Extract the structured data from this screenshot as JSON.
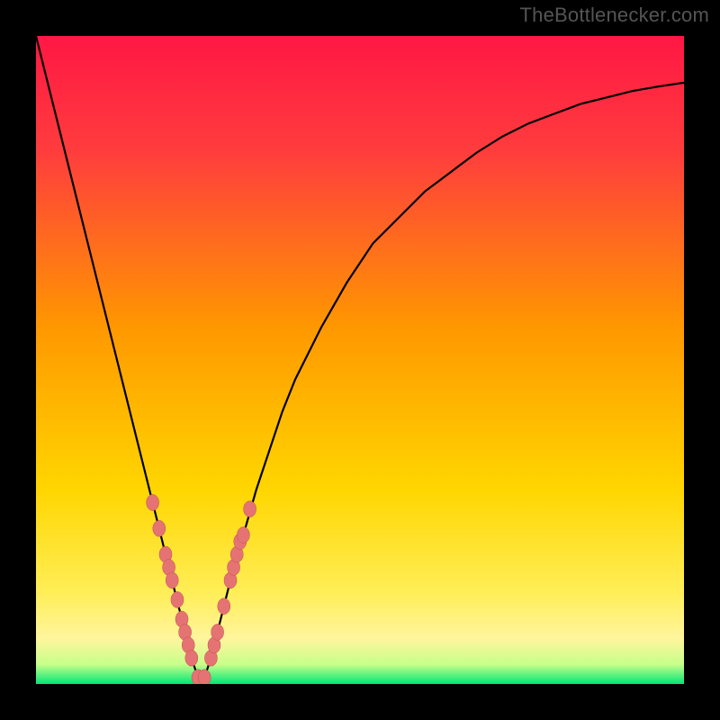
{
  "watermark": "TheBottlenecker.com",
  "colors": {
    "frame": "#000000",
    "gradient_top": "#ff1744",
    "gradient_mid1": "#ff5722",
    "gradient_mid2": "#ffd600",
    "gradient_mid3": "#ffee58",
    "gradient_bottom_band": "#fff59d",
    "gradient_green": "#00e676",
    "curve": "#000000",
    "marker_fill": "#e57373",
    "marker_stroke": "#c05050"
  },
  "chart_data": {
    "type": "line",
    "title": "",
    "xlabel": "",
    "ylabel": "",
    "xlim": [
      0,
      100
    ],
    "ylim": [
      0,
      100
    ],
    "curve": {
      "x": [
        0,
        2,
        4,
        6,
        8,
        10,
        12,
        14,
        16,
        18,
        20,
        21,
        22,
        23,
        24,
        25,
        26,
        27,
        28,
        29,
        30,
        32,
        34,
        36,
        38,
        40,
        44,
        48,
        52,
        56,
        60,
        64,
        68,
        72,
        76,
        80,
        84,
        88,
        92,
        96,
        100
      ],
      "y": [
        100,
        92,
        84,
        76,
        68,
        60,
        52,
        44,
        36,
        28,
        20,
        16,
        12,
        8,
        4,
        1,
        1,
        4,
        8,
        12,
        16,
        23,
        30,
        36,
        42,
        47,
        55,
        62,
        68,
        72,
        76,
        79,
        82,
        84.5,
        86.5,
        88,
        89.5,
        90.5,
        91.5,
        92.2,
        92.8
      ]
    },
    "markers": {
      "x": [
        18,
        19,
        20,
        20.5,
        21,
        21.8,
        22.5,
        23,
        23.5,
        24,
        25,
        26,
        27,
        27.5,
        28,
        29,
        30,
        30.5,
        31,
        31.5,
        32,
        33
      ],
      "y": [
        28,
        24,
        20,
        18,
        16,
        13,
        10,
        8,
        6,
        4,
        1,
        1,
        4,
        6,
        8,
        12,
        16,
        18,
        20,
        22,
        23,
        27
      ]
    },
    "green_band_y_range": [
      0,
      3
    ],
    "light_band_y_range": [
      3,
      15
    ]
  }
}
